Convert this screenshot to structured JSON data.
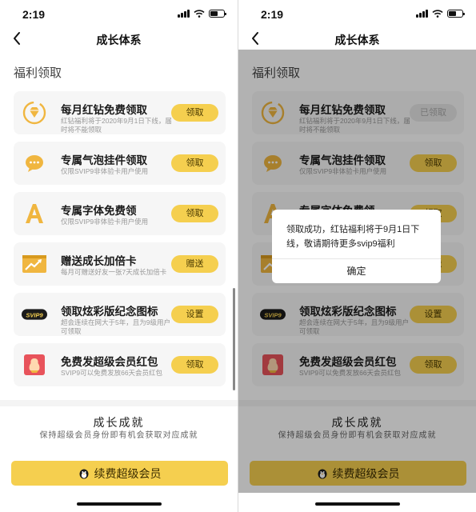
{
  "status": {
    "time": "2:19"
  },
  "nav": {
    "title": "成长体系"
  },
  "section": {
    "title": "福利领取"
  },
  "cards": [
    {
      "title": "每月红钻免费领取",
      "subtitle": "红钻福利将于2020年9月1日下线，届时将不能领取",
      "button": "领取",
      "icon": "red-diamond-icon"
    },
    {
      "title": "专属气泡挂件领取",
      "subtitle": "仅限SVIP9非体验卡用户使用",
      "button": "领取",
      "icon": "chat-bubble-icon"
    },
    {
      "title": "专属字体免费领",
      "subtitle": "仅限SVIP9非体验卡用户使用",
      "button": "领取",
      "icon": "font-a-icon"
    },
    {
      "title": "赠送成长加倍卡",
      "subtitle": "每月可赠送好友一张7天成长加倍卡",
      "button": "赠送",
      "icon": "growth-card-icon"
    },
    {
      "title": "领取炫彩版纪念图标",
      "subtitle": "超会连续在网大于5年，且为9级用户可领取",
      "button": "设置",
      "icon": "svip9-badge-icon"
    },
    {
      "title": "免费发超级会员红包",
      "subtitle": "SVIP9可以免费发放66天会员红包",
      "button": "领取",
      "icon": "red-envelope-icon"
    }
  ],
  "right_first_button": "已领取",
  "svip_badge_text": "SVIP9",
  "achievement": {
    "title": "成长成就",
    "subtitle": "保持超级会员身份即有机会获取对应成就"
  },
  "renew_button": "续费超级会员",
  "dialog": {
    "message": "领取成功，红钻福利将于9月1日下线，敬请期待更多svip9福利",
    "confirm": "确定"
  },
  "colors": {
    "accent_yellow": "#f5cf4f",
    "icon_orange": "#f0b640",
    "claimed_gray": "#e6e6e6"
  }
}
